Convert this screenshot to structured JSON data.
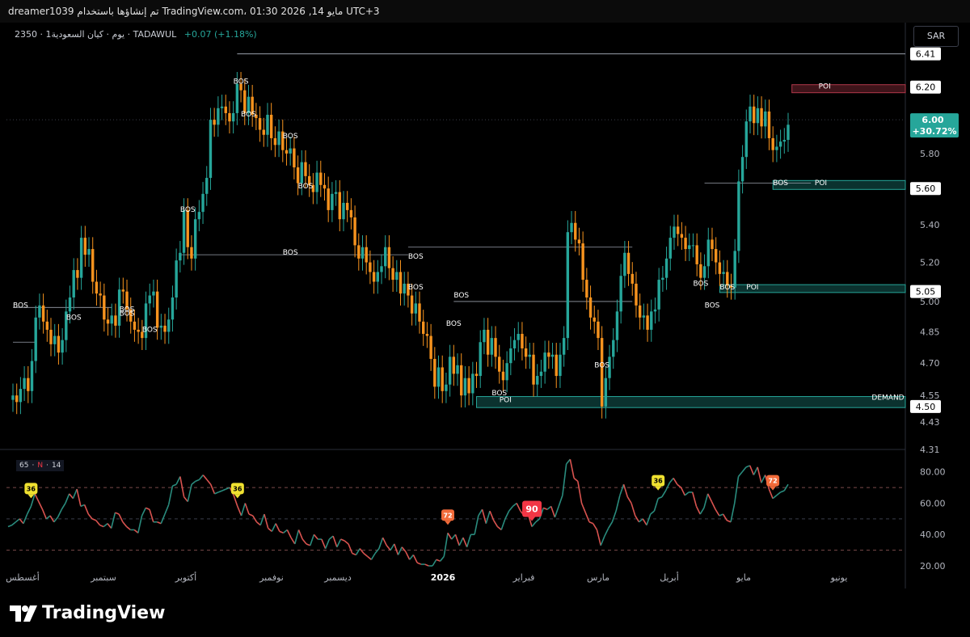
{
  "header": {
    "text": "dreamer1039 تم إنشاؤها باستخدام TradingView.com، 01:30 2026 ,14 مايو UTC+3"
  },
  "symbol": {
    "line": "2350 · 1يوم · كيان السعودية · TADAWUL",
    "change": "+0.07 (+1.18%)"
  },
  "currency": "SAR",
  "rsi_params": {
    "a": "65",
    "b": "N",
    "c": "14"
  },
  "footer": {
    "logo_text": "TradingView"
  },
  "colors": {
    "background": "#000000",
    "bull": "#26a69a",
    "bear": "#f7931e",
    "rsi_up": "#2a8c7e",
    "rsi_down": "#d9534f",
    "demand_zone": "#26a69a",
    "poi_zone_red": "#b2384a",
    "price_tag_current": "#26a69a"
  },
  "chart_data": [
    {
      "type": "candlestick",
      "ylim": [
        4.31,
        6.55
      ],
      "y_scale": "log",
      "y_ticks": [
        "6.41",
        "6.20",
        "6.00",
        "5.80",
        "5.60",
        "5.40",
        "5.20",
        "5.05",
        "5.00",
        "4.85",
        "4.70",
        "4.55",
        "4.50",
        "4.43",
        "4.31"
      ],
      "last_price": {
        "label": "6.00",
        "change": "+30.72%"
      },
      "x_labels": [
        "أغسطس",
        "سبتمبر",
        "أكتوبر",
        "نوفمبر",
        "ديسمبر",
        "2026",
        "فبراير",
        "مارس",
        "أبريل",
        "مايو",
        "يونيو"
      ],
      "close": [
        4.55,
        4.52,
        4.58,
        4.63,
        4.57,
        4.71,
        4.92,
        4.98,
        4.9,
        4.86,
        4.79,
        4.83,
        4.75,
        4.81,
        4.95,
        5.02,
        5.16,
        5.12,
        5.33,
        5.24,
        5.27,
        5.1,
        5.04,
        5.03,
        4.91,
        4.89,
        4.93,
        4.88,
        5.06,
        5.05,
        4.96,
        4.9,
        4.86,
        4.85,
        4.82,
        4.99,
        5.03,
        5.05,
        4.87,
        4.88,
        4.85,
        4.91,
        5.02,
        5.21,
        5.25,
        5.48,
        5.28,
        5.22,
        5.43,
        5.47,
        5.57,
        5.66,
        6.0,
        5.97,
        6.07,
        6.08,
        6.04,
        5.99,
        6.04,
        6.22,
        6.18,
        6.04,
        6.14,
        6.03,
        6.01,
        5.94,
        5.91,
        6.03,
        5.89,
        5.85,
        5.93,
        5.82,
        5.8,
        5.83,
        5.72,
        5.63,
        5.75,
        5.67,
        5.62,
        5.58,
        5.69,
        5.62,
        5.6,
        5.48,
        5.57,
        5.58,
        5.43,
        5.52,
        5.48,
        5.44,
        5.29,
        5.22,
        5.28,
        5.2,
        5.15,
        5.1,
        5.15,
        5.18,
        5.28,
        5.17,
        5.11,
        5.15,
        5.04,
        5.09,
        5.03,
        4.94,
        4.99,
        4.9,
        4.84,
        4.83,
        4.72,
        4.59,
        4.68,
        4.57,
        4.6,
        4.73,
        4.65,
        4.69,
        4.55,
        4.63,
        4.56,
        4.65,
        4.64,
        4.8,
        4.86,
        4.74,
        4.82,
        4.73,
        4.66,
        4.62,
        4.7,
        4.77,
        4.81,
        4.84,
        4.77,
        4.73,
        4.74,
        4.6,
        4.64,
        4.66,
        4.75,
        4.73,
        4.74,
        4.64,
        4.74,
        4.82,
        5.36,
        5.41,
        5.32,
        5.3,
        5.11,
        5.02,
        4.92,
        4.9,
        4.82,
        4.5,
        4.63,
        4.73,
        4.81,
        4.95,
        5.13,
        5.25,
        5.14,
        5.09,
        4.98,
        4.92,
        4.93,
        4.86,
        4.95,
        4.96,
        5.11,
        5.12,
        5.22,
        5.33,
        5.39,
        5.35,
        5.33,
        5.27,
        5.29,
        5.29,
        5.19,
        5.12,
        5.18,
        5.32,
        5.27,
        5.2,
        5.14,
        5.15,
        5.08,
        5.07,
        5.26,
        5.64,
        5.78,
        5.99,
        6.08,
        5.98,
        6.07,
        5.96,
        6.05,
        5.89,
        5.82,
        5.84,
        5.87,
        5.88,
        5.97
      ]
    },
    {
      "type": "line",
      "title": "RSI",
      "ylim": [
        20,
        85
      ],
      "y_ticks": [
        "80.00",
        "60.00",
        "40.00",
        "20.00"
      ],
      "reference_lines": [
        70,
        50,
        30
      ],
      "badges": [
        {
          "label": "36",
          "color": "#f0e130"
        },
        {
          "label": "36",
          "color": "#f0e130"
        },
        {
          "label": "72",
          "color": "#f26b3a"
        },
        {
          "label": "90",
          "color": "#f23645"
        },
        {
          "label": "36",
          "color": "#f0e130"
        },
        {
          "label": "72",
          "color": "#f26b3a"
        }
      ],
      "values": [
        45,
        46,
        48,
        50,
        47,
        53,
        58,
        66,
        61,
        56,
        50,
        52,
        48,
        51,
        56,
        60,
        66,
        63,
        69,
        58,
        59,
        53,
        50,
        49,
        46,
        45,
        47,
        44,
        54,
        53,
        48,
        45,
        43,
        43,
        41,
        52,
        57,
        56,
        48,
        48,
        47,
        53,
        59,
        71,
        72,
        77,
        64,
        61,
        72,
        74,
        75,
        78,
        75,
        72,
        66,
        67,
        68,
        69,
        70,
        65,
        58,
        52,
        60,
        53,
        52,
        48,
        46,
        53,
        44,
        42,
        47,
        42,
        41,
        43,
        38,
        34,
        43,
        37,
        34,
        33,
        40,
        37,
        37,
        31,
        37,
        39,
        32,
        37,
        36,
        34,
        28,
        27,
        31,
        28,
        26,
        24,
        28,
        31,
        38,
        33,
        30,
        34,
        27,
        32,
        29,
        24,
        27,
        22,
        21,
        21,
        20,
        20,
        24,
        23,
        26,
        41,
        37,
        40,
        33,
        38,
        32,
        40,
        40,
        52,
        56,
        47,
        55,
        49,
        45,
        43,
        50,
        55,
        58,
        60,
        55,
        52,
        53,
        45,
        48,
        50,
        57,
        56,
        58,
        51,
        58,
        65,
        85,
        88,
        76,
        74,
        60,
        54,
        48,
        47,
        43,
        33,
        39,
        44,
        48,
        55,
        65,
        72,
        64,
        60,
        52,
        48,
        50,
        46,
        53,
        55,
        63,
        64,
        68,
        73,
        76,
        72,
        70,
        65,
        67,
        67,
        58,
        53,
        57,
        66,
        61,
        56,
        52,
        53,
        49,
        48,
        60,
        77,
        80,
        83,
        84,
        78,
        83,
        73,
        78,
        69,
        63,
        65,
        67,
        68,
        72
      ]
    }
  ],
  "annotations": {
    "bos": [
      "BOS",
      "BOS",
      "BOS",
      "BOS",
      "BOS",
      "BOS",
      "BOS",
      "BOS",
      "BOS",
      "BOS",
      "BOS",
      "BOS",
      "BOS",
      "BOS",
      "BOS",
      "BOS",
      "BOS",
      "BOS",
      "BOS",
      "BOS",
      "BOS"
    ],
    "poi": [
      "POI",
      "POI",
      "POI",
      "POI"
    ],
    "demand": "DEMAND"
  }
}
